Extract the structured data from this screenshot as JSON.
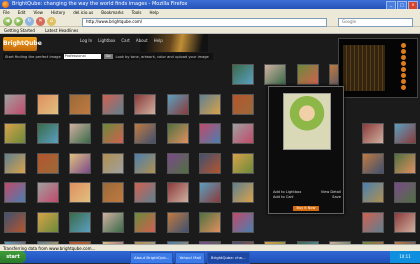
{
  "window": {
    "title": "BrightQube: changing the way the world finds images - Mozilla Firefox"
  },
  "menu": [
    "File",
    "Edit",
    "View",
    "History",
    "del.icio.us",
    "Bookmarks",
    "Tools",
    "Help"
  ],
  "address": {
    "url": "http://www.brightqube.com/"
  },
  "search": {
    "placeholder": "Google"
  },
  "bookmarks": [
    "Getting Started",
    "Latest Headlines"
  ],
  "site": {
    "logo": "BrightQube",
    "nav": [
      "Log In",
      "Lightbox",
      "Cart",
      "About",
      "Help"
    ],
    "search_label": "Start finding the perfect image",
    "search_value": "Professional",
    "search_button": "Go",
    "search_hint": "Look by tone, artwork, color and upload your image"
  },
  "popup": {
    "add_lightbox": "Add to Lightbox",
    "view_detail": "View Detail",
    "add_cart": "Add to Cart",
    "save": "Save",
    "buy": "Buy it Now"
  },
  "status": "Transferring data from www.brightqube.com...",
  "taskbar": {
    "start": "start",
    "tasks": [
      "About BrightQub...",
      "Yahoo! Mail",
      "BrightQube: cha..."
    ],
    "clock": "10:11"
  },
  "thumbnails": [
    "#b5552c",
    "#4a7fb0",
    "#d8a24a",
    "#6b8a3a",
    "#c04a6a",
    "#9a6a3a",
    "#5aa0c0",
    "#e0c080",
    "#7a4a8a",
    "#3a6a4a",
    "#c07a40",
    "#a0a0a0",
    "#d06050",
    "#608090",
    "#b09050",
    "#405070",
    "#d0b0a0",
    "#507040",
    "#e09060",
    "#8a3a3a"
  ]
}
